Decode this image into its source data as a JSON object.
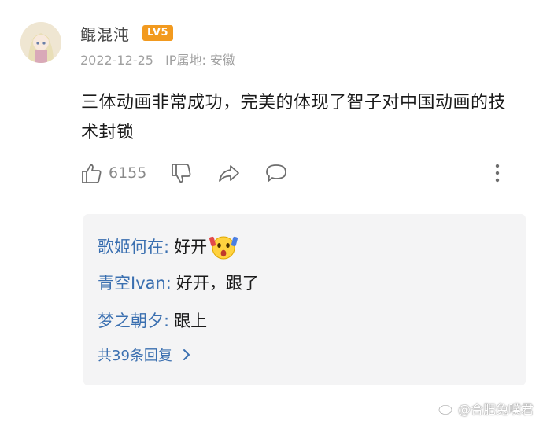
{
  "comment": {
    "username": "鲲混沌",
    "level_badge": "LV5",
    "date": "2022-12-25",
    "ip_location": "IP属地: 安徽",
    "text": "三体动画非常成功，完美的体现了智子对中国动画的技术封锁",
    "like_count": "6155"
  },
  "replies": [
    {
      "author": "歌姬何在:",
      "text": "好开"
    },
    {
      "author": "青空Ivan:",
      "text": "好开，跟了"
    },
    {
      "author": "梦之朝夕:",
      "text": "跟上"
    }
  ],
  "more_replies_label": "共39条回复",
  "watermark": "@合肥兔噗君",
  "colors": {
    "link_blue": "#3a6fb0",
    "badge_orange": "#f29a1f",
    "reply_bg": "#f4f4f5"
  },
  "icons": [
    "like-icon",
    "dislike-icon",
    "share-icon",
    "comment-icon",
    "more-vertical-icon",
    "chevron-right-icon",
    "shocked-emoji-icon",
    "weibo-logo-icon"
  ]
}
